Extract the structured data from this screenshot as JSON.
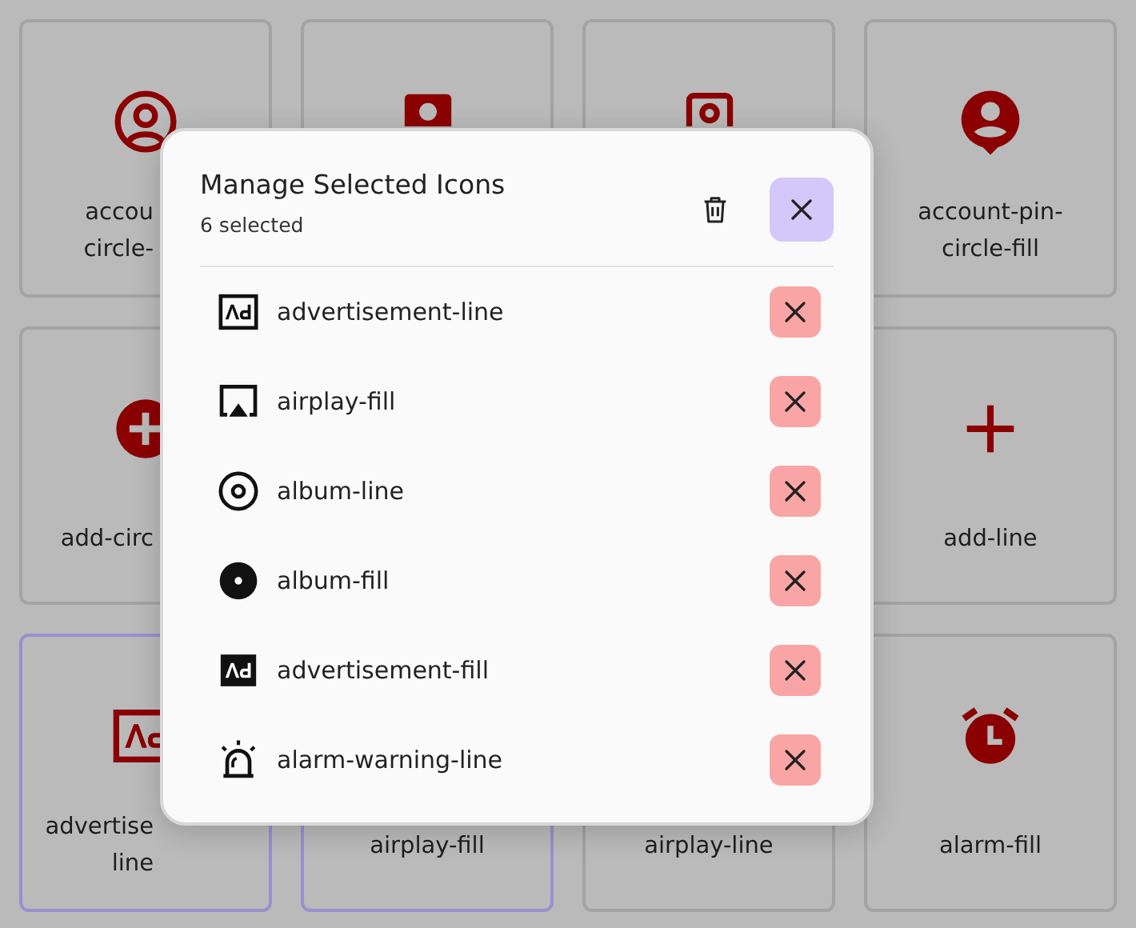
{
  "cards": [
    {
      "label_lines": [
        "accou",
        "circle-"
      ],
      "selected": false
    },
    {
      "selected": false
    },
    {
      "selected": false
    },
    {
      "label_lines": [
        "account-pin-",
        "circle-fill"
      ],
      "selected": false
    },
    {
      "label_lines": [
        "add-circ"
      ],
      "selected": false
    },
    {
      "label_lines": [
        "add-line"
      ],
      "selected": false
    },
    {
      "label_lines": [
        "advertise",
        "line"
      ],
      "selected": true
    },
    {
      "label_lines": [
        "airplay-fill"
      ],
      "selected": true
    },
    {
      "label_lines": [
        "airplay-line"
      ],
      "selected": false
    },
    {
      "label_lines": [
        "alarm-fill"
      ],
      "selected": false
    }
  ],
  "dialog": {
    "title": "Manage Selected Icons",
    "subtitle": "6 selected",
    "items": [
      {
        "name": "advertisement-line"
      },
      {
        "name": "airplay-fill"
      },
      {
        "name": "album-line"
      },
      {
        "name": "album-fill"
      },
      {
        "name": "advertisement-fill"
      },
      {
        "name": "alarm-warning-line"
      }
    ]
  }
}
